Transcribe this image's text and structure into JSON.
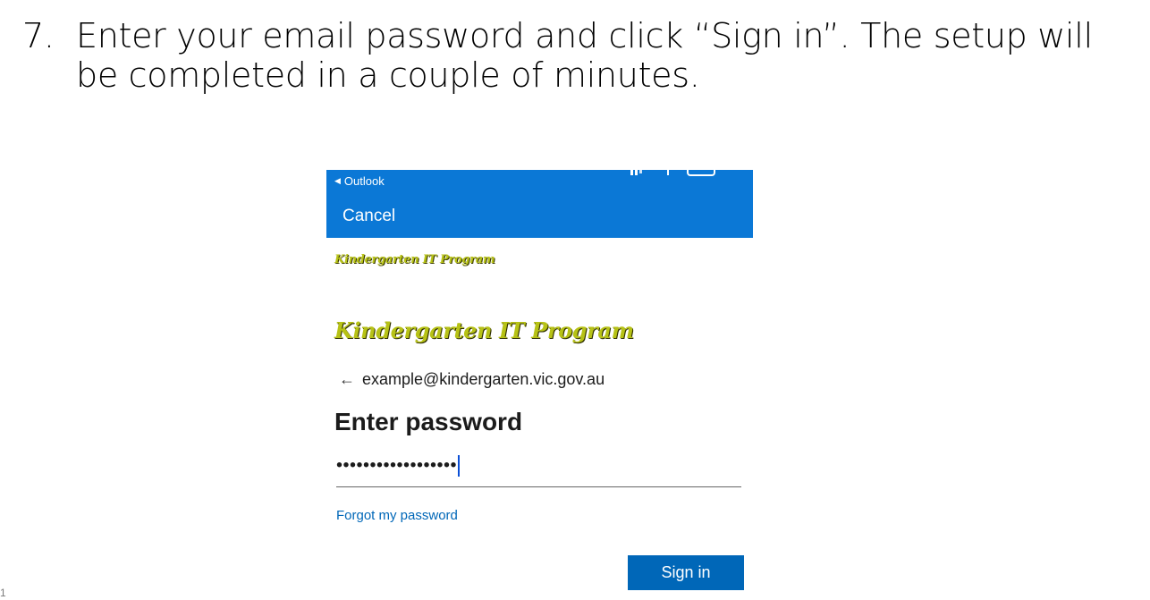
{
  "instruction": {
    "number": "7.",
    "text": "Enter your email password and click “Sign in”. The setup will be completed in a couple of minutes."
  },
  "slide_number": "1",
  "phone": {
    "back_label": "Outlook",
    "cancel_label": "Cancel",
    "logo_small": "Kindergarten IT Program",
    "logo_large": "Kindergarten IT Program",
    "account_email": "example@kindergarten.vic.gov.au",
    "heading": "Enter password",
    "password_value": "••••••••••••••••••",
    "forgot_label": "Forgot my password",
    "signin_label": "Sign in"
  },
  "colors": {
    "top_bar": "#0b78d6",
    "primary_button": "#0067b8",
    "link": "#0067b8",
    "logo_text": "#b7c216"
  }
}
